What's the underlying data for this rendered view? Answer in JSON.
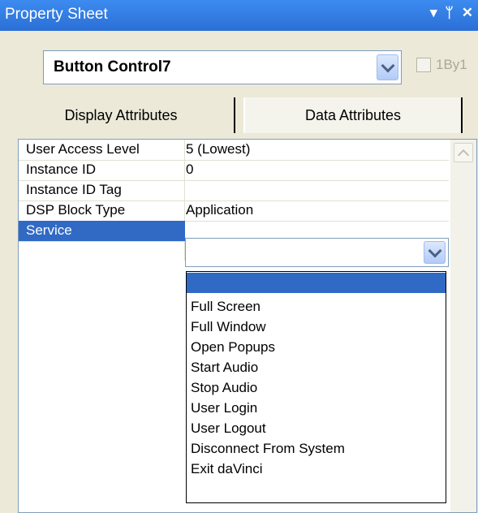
{
  "window": {
    "title": "Property Sheet",
    "controls": [
      "▾",
      "ᛘ",
      "✕"
    ]
  },
  "object_selector": {
    "value": "Button Control7",
    "onebyone_label": "1By1"
  },
  "tabs": [
    {
      "label": "Display Attributes"
    },
    {
      "label": "Data Attributes"
    }
  ],
  "properties": [
    {
      "name": "User Access Level",
      "value": "5 (Lowest)"
    },
    {
      "name": "Instance ID",
      "value": "0"
    },
    {
      "name": "Instance ID Tag",
      "value": ""
    },
    {
      "name": "DSP Block Type",
      "value": "Application"
    },
    {
      "name": "Service",
      "value": ""
    }
  ],
  "service_dropdown": {
    "selected": "",
    "options": [
      "",
      "Full Screen",
      "Full Window",
      "Open Popups",
      "Start Audio",
      "Stop Audio",
      "User Login",
      "User Logout",
      "Disconnect From System",
      "Exit daVinci"
    ]
  },
  "colors": {
    "title_bar": "#2A6FD6",
    "selection": "#316AC5",
    "panel_bg": "#ECE9D8"
  }
}
